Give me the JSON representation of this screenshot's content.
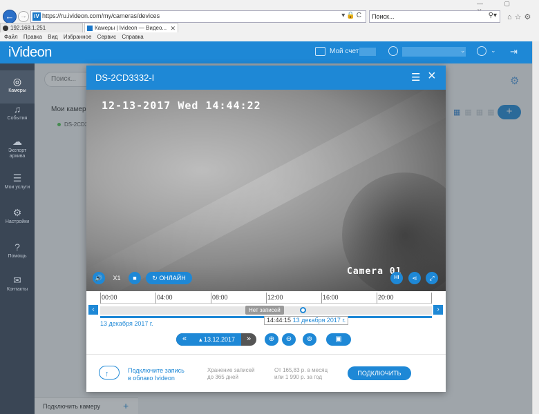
{
  "browser": {
    "url": "https://ru.ivideon.com/my/cameras/devices",
    "search_placeholder": "Поиск...",
    "tabs": [
      {
        "label": "192.168.1.251"
      },
      {
        "label": "Камеры | Ivideon — Видео..."
      }
    ],
    "menu": [
      "Файл",
      "Правка",
      "Вид",
      "Избранное",
      "Сервис",
      "Справка"
    ]
  },
  "header": {
    "logo": "iVideon",
    "account_label": "Мой счет:"
  },
  "sidebar": {
    "items": [
      {
        "label": "Камеры",
        "icon": "camera-icon"
      },
      {
        "label": "События",
        "icon": "bell-icon"
      },
      {
        "label": "Экспорт архива",
        "icon": "cloud-icon"
      },
      {
        "label": "Мои услуги",
        "icon": "list-icon"
      },
      {
        "label": "Настройки",
        "icon": "gear-icon"
      },
      {
        "label": "Помощь",
        "icon": "question-icon"
      },
      {
        "label": "Контакты",
        "icon": "mail-icon"
      }
    ]
  },
  "main": {
    "search_placeholder": "Поиск...",
    "tree_title": "Мои камер",
    "tree_item": "DS-2CD3",
    "add_camera": "Подключить камеру"
  },
  "modal": {
    "title": "DS-2CD3332-I",
    "video": {
      "timestamp": "12-13-2017 Wed 14:44:22",
      "camera_label": "Camera 01",
      "speed": "X1",
      "online_label": "ОНЛАЙН",
      "quality": "HI"
    },
    "timeline": {
      "hours": [
        "00:00",
        "04:00",
        "08:00",
        "12:00",
        "16:00",
        "20:00"
      ],
      "no_records": "Нет записей",
      "current_time": "14:44:15",
      "current_date": "13 декабря 2017 г.",
      "date_label": "13 декабря 2017 г."
    },
    "controls": {
      "date": "13.12.2017"
    },
    "promo": {
      "text1_line1": "Подключите запись",
      "text1_line2": "в облако Ivideon",
      "text2_line1": "Хранение записей",
      "text2_line2": "до 365 дней",
      "text3_line1": "От 165,83 р. в месяц",
      "text3_line2": "или 1 990 р. за год",
      "button": "ПОДКЛЮЧИТЬ"
    }
  },
  "colors": {
    "accent": "#1e88d6",
    "sidebar": "#3a4655"
  }
}
